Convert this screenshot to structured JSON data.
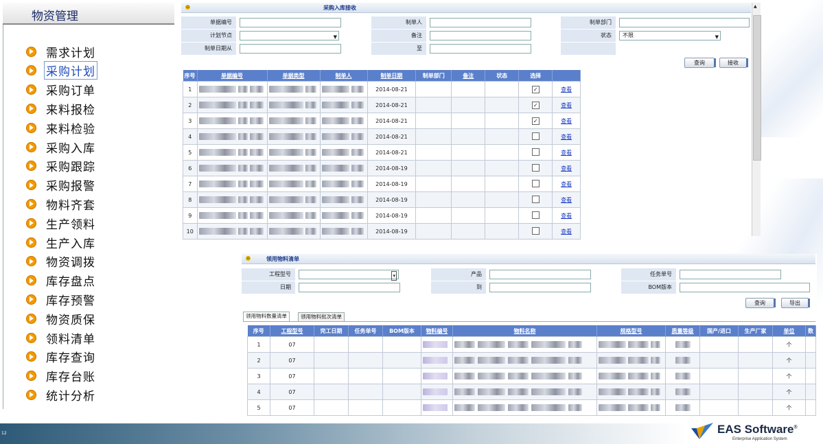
{
  "sidebar": {
    "title": "物资管理",
    "items": [
      "需求计划",
      "采购计划",
      "采购订单",
      "来料报检",
      "来料检验",
      "采购入库",
      "采购跟踪",
      "采购报警",
      "物料齐套",
      "生产领料",
      "生产入库",
      "物资调拨",
      "库存盘点",
      "库存预警",
      "物资质保",
      "领料清单",
      "库存查询",
      "库存台账",
      "统计分析"
    ],
    "selected": "采购计划"
  },
  "receipt_window": {
    "title": "采购入库接收",
    "form": {
      "doc_no_label": "单据编号",
      "creator_label": "制单人",
      "dept_label": "制单部门",
      "plan_node_label": "计划节点",
      "remark_label": "备注",
      "status_label": "状态",
      "status_value": "不限",
      "date_from_label": "制单日期从",
      "date_to_label": "至"
    },
    "buttons": {
      "query": "查询",
      "receive": "接收"
    },
    "columns": [
      "序号",
      "单据编号",
      "单据类型",
      "制单人",
      "制单日期",
      "制单部门",
      "备注",
      "状态",
      "选择",
      ""
    ],
    "rows": [
      {
        "no": "1",
        "date": "2014-08-21",
        "checked": true,
        "action": "查看"
      },
      {
        "no": "2",
        "date": "2014-08-21",
        "checked": true,
        "action": "查看"
      },
      {
        "no": "3",
        "date": "2014-08-21",
        "checked": true,
        "action": "查看"
      },
      {
        "no": "4",
        "date": "2014-08-21",
        "checked": false,
        "action": "查看"
      },
      {
        "no": "5",
        "date": "2014-08-21",
        "checked": false,
        "action": "查看"
      },
      {
        "no": "6",
        "date": "2014-08-19",
        "checked": false,
        "action": "查看"
      },
      {
        "no": "7",
        "date": "2014-08-19",
        "checked": false,
        "action": "查看"
      },
      {
        "no": "8",
        "date": "2014-08-19",
        "checked": false,
        "action": "查看"
      },
      {
        "no": "9",
        "date": "2014-08-19",
        "checked": false,
        "action": "查看"
      },
      {
        "no": "10",
        "date": "2014-08-19",
        "checked": false,
        "action": "查看"
      }
    ]
  },
  "material_window": {
    "title": "领用物料清单",
    "form": {
      "project_label": "工程型号",
      "product_label": "产品",
      "task_label": "任务单号",
      "date_label": "日期",
      "to_label": "到",
      "bom_label": "BOM版本"
    },
    "buttons": {
      "query": "查询",
      "export": "导出"
    },
    "tabs": [
      "领用物料数量清单",
      "领用物料批次清单"
    ],
    "columns": [
      "序号",
      "工程型号",
      "完工日期",
      "任务单号",
      "BOM版本",
      "物料编号",
      "物料名称",
      "规格型号",
      "质量等级",
      "国产/进口",
      "生产厂家",
      "单位",
      "数"
    ],
    "rows": [
      {
        "no": "1",
        "model": "07",
        "unit": "个"
      },
      {
        "no": "2",
        "model": "07",
        "unit": "个"
      },
      {
        "no": "3",
        "model": "07",
        "unit": "个"
      },
      {
        "no": "4",
        "model": "07",
        "unit": "个"
      },
      {
        "no": "5",
        "model": "07",
        "unit": "个"
      }
    ]
  },
  "footer": {
    "page_number": "12",
    "logo_text": "EAS Software",
    "logo_mark": "®",
    "logo_sub": "Enterprise Application System"
  }
}
